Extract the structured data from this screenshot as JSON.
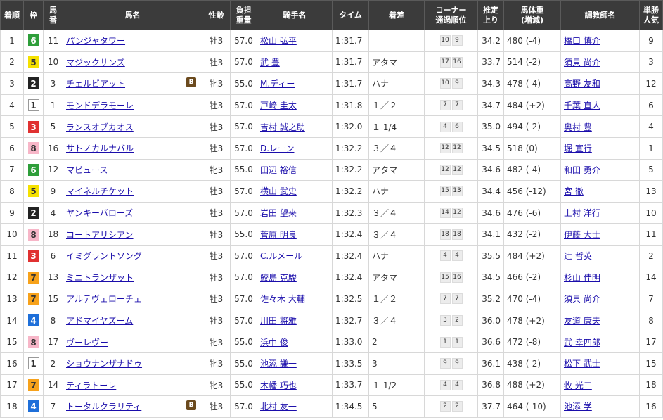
{
  "headers": {
    "rank": "着順",
    "waku": "枠",
    "umaban_1": "馬",
    "umaban_2": "番",
    "horse": "馬名",
    "sex_age": "性齢",
    "weight_1": "負担",
    "weight_2": "重量",
    "jockey": "騎手名",
    "time": "タイム",
    "margin": "着差",
    "corner_1": "コーナー",
    "corner_2": "通過順位",
    "last3f_1": "推定",
    "last3f_2": "上り",
    "body_1": "馬体重",
    "body_2": "(増減)",
    "trainer": "調教師名",
    "pop_1": "単勝",
    "pop_2": "人気"
  },
  "waku_colors": {
    "1": {
      "bg": "#ffffff",
      "fg": "#333333",
      "border": "#999999"
    },
    "2": {
      "bg": "#222222",
      "fg": "#ffffff",
      "border": "#222222"
    },
    "3": {
      "bg": "#e03131",
      "fg": "#ffffff",
      "border": "#e03131"
    },
    "4": {
      "bg": "#1e6fd9",
      "fg": "#ffffff",
      "border": "#1e6fd9"
    },
    "5": {
      "bg": "#f5e100",
      "fg": "#333333",
      "border": "#f5e100"
    },
    "6": {
      "bg": "#2e9e3a",
      "fg": "#ffffff",
      "border": "#2e9e3a"
    },
    "7": {
      "bg": "#f7a21b",
      "fg": "#333333",
      "border": "#f7a21b"
    },
    "8": {
      "bg": "#f7b6c8",
      "fg": "#333333",
      "border": "#f7b6c8"
    }
  },
  "blinker_label": "B",
  "rows": [
    {
      "rank": "1",
      "waku": "6",
      "umaban": "11",
      "horse": "パンジャタワー",
      "blinker": false,
      "sex_age": "牡3",
      "weight": "57.0",
      "jockey": "松山 弘平",
      "time": "1:31.7",
      "margin": "",
      "corner": [
        "10",
        "9"
      ],
      "last3f": "34.2",
      "body": "480 (-4)",
      "trainer": "橋口 慎介",
      "pop": "9"
    },
    {
      "rank": "2",
      "waku": "5",
      "umaban": "10",
      "horse": "マジックサンズ",
      "blinker": false,
      "sex_age": "牡3",
      "weight": "57.0",
      "jockey": "武 豊",
      "time": "1:31.7",
      "margin": "アタマ",
      "corner": [
        "17",
        "16"
      ],
      "last3f": "33.7",
      "body": "514 (-2)",
      "trainer": "須貝 尚介",
      "pop": "3"
    },
    {
      "rank": "3",
      "waku": "2",
      "umaban": "3",
      "horse": "チェルビアット",
      "blinker": true,
      "sex_age": "牝3",
      "weight": "55.0",
      "jockey": "M.ディー",
      "time": "1:31.7",
      "margin": "ハナ",
      "corner": [
        "10",
        "9"
      ],
      "last3f": "34.3",
      "body": "478 (-4)",
      "trainer": "高野 友和",
      "pop": "12"
    },
    {
      "rank": "4",
      "waku": "1",
      "umaban": "1",
      "horse": "モンドデラモーレ",
      "blinker": false,
      "sex_age": "牡3",
      "weight": "57.0",
      "jockey": "戸崎 圭太",
      "time": "1:31.8",
      "margin": "１／２",
      "corner": [
        "7",
        "7"
      ],
      "last3f": "34.7",
      "body": "484 (+2)",
      "trainer": "千葉 直人",
      "pop": "6"
    },
    {
      "rank": "5",
      "waku": "3",
      "umaban": "5",
      "horse": "ランスオブカオス",
      "blinker": false,
      "sex_age": "牡3",
      "weight": "57.0",
      "jockey": "吉村 誠之助",
      "time": "1:32.0",
      "margin": "１ 1/4",
      "corner": [
        "4",
        "6"
      ],
      "last3f": "35.0",
      "body": "494 (-2)",
      "trainer": "奥村 豊",
      "pop": "4"
    },
    {
      "rank": "6",
      "waku": "8",
      "umaban": "16",
      "horse": "サトノカルナバル",
      "blinker": false,
      "sex_age": "牡3",
      "weight": "57.0",
      "jockey": "D.レーン",
      "time": "1:32.2",
      "margin": "３／４",
      "corner": [
        "12",
        "12"
      ],
      "last3f": "34.5",
      "body": "518 (0)",
      "trainer": "堀 宣行",
      "pop": "1"
    },
    {
      "rank": "7",
      "waku": "6",
      "umaban": "12",
      "horse": "マピュース",
      "blinker": false,
      "sex_age": "牝3",
      "weight": "55.0",
      "jockey": "田辺 裕信",
      "time": "1:32.2",
      "margin": "アタマ",
      "corner": [
        "12",
        "12"
      ],
      "last3f": "34.6",
      "body": "482 (-4)",
      "trainer": "和田 勇介",
      "pop": "5"
    },
    {
      "rank": "8",
      "waku": "5",
      "umaban": "9",
      "horse": "マイネルチケット",
      "blinker": false,
      "sex_age": "牡3",
      "weight": "57.0",
      "jockey": "横山 武史",
      "time": "1:32.2",
      "margin": "ハナ",
      "corner": [
        "15",
        "13"
      ],
      "last3f": "34.4",
      "body": "456 (-12)",
      "trainer": "宮 徹",
      "pop": "13"
    },
    {
      "rank": "9",
      "waku": "2",
      "umaban": "4",
      "horse": "ヤンキーバローズ",
      "blinker": false,
      "sex_age": "牡3",
      "weight": "57.0",
      "jockey": "岩田 望来",
      "time": "1:32.3",
      "margin": "３／４",
      "corner": [
        "14",
        "12"
      ],
      "last3f": "34.6",
      "body": "476 (-6)",
      "trainer": "上村 洋行",
      "pop": "10"
    },
    {
      "rank": "10",
      "waku": "8",
      "umaban": "18",
      "horse": "コートアリシアン",
      "blinker": false,
      "sex_age": "牡3",
      "weight": "55.0",
      "jockey": "菅原 明良",
      "time": "1:32.4",
      "margin": "３／４",
      "corner": [
        "18",
        "18"
      ],
      "last3f": "34.1",
      "body": "432 (-2)",
      "trainer": "伊藤 大士",
      "pop": "11"
    },
    {
      "rank": "11",
      "waku": "3",
      "umaban": "6",
      "horse": "イミグラントソング",
      "blinker": false,
      "sex_age": "牡3",
      "weight": "57.0",
      "jockey": "C.ルメール",
      "time": "1:32.4",
      "margin": "ハナ",
      "corner": [
        "4",
        "4"
      ],
      "last3f": "35.5",
      "body": "484 (+2)",
      "trainer": "辻 哲英",
      "pop": "2"
    },
    {
      "rank": "12",
      "waku": "7",
      "umaban": "13",
      "horse": "ミニトランザット",
      "blinker": false,
      "sex_age": "牡3",
      "weight": "57.0",
      "jockey": "鮫島 克駿",
      "time": "1:32.4",
      "margin": "アタマ",
      "corner": [
        "15",
        "16"
      ],
      "last3f": "34.5",
      "body": "466 (-2)",
      "trainer": "杉山 佳明",
      "pop": "14"
    },
    {
      "rank": "13",
      "waku": "7",
      "umaban": "15",
      "horse": "アルテヴェローチェ",
      "blinker": false,
      "sex_age": "牡3",
      "weight": "57.0",
      "jockey": "佐々木 大輔",
      "time": "1:32.5",
      "margin": "１／２",
      "corner": [
        "7",
        "7"
      ],
      "last3f": "35.2",
      "body": "470 (-4)",
      "trainer": "須貝 尚介",
      "pop": "7"
    },
    {
      "rank": "14",
      "waku": "4",
      "umaban": "8",
      "horse": "アドマイヤズーム",
      "blinker": false,
      "sex_age": "牡3",
      "weight": "57.0",
      "jockey": "川田 将雅",
      "time": "1:32.7",
      "margin": "３／４",
      "corner": [
        "3",
        "2"
      ],
      "last3f": "36.0",
      "body": "478 (+2)",
      "trainer": "友道 康夫",
      "pop": "8"
    },
    {
      "rank": "15",
      "waku": "8",
      "umaban": "17",
      "horse": "ヴーレヴー",
      "blinker": false,
      "sex_age": "牝3",
      "weight": "55.0",
      "jockey": "浜中 俊",
      "time": "1:33.0",
      "margin": "2",
      "corner": [
        "1",
        "1"
      ],
      "last3f": "36.6",
      "body": "472 (-8)",
      "trainer": "武 幸四郎",
      "pop": "17"
    },
    {
      "rank": "16",
      "waku": "1",
      "umaban": "2",
      "horse": "ショウナンザナドゥ",
      "blinker": false,
      "sex_age": "牝3",
      "weight": "55.0",
      "jockey": "池添 謙一",
      "time": "1:33.5",
      "margin": "3",
      "corner": [
        "9",
        "9"
      ],
      "last3f": "36.1",
      "body": "438 (-2)",
      "trainer": "松下 武士",
      "pop": "15"
    },
    {
      "rank": "17",
      "waku": "7",
      "umaban": "14",
      "horse": "ティラトーレ",
      "blinker": false,
      "sex_age": "牝3",
      "weight": "55.0",
      "jockey": "木幡 巧也",
      "time": "1:33.7",
      "margin": "１ 1/2",
      "corner": [
        "4",
        "4"
      ],
      "last3f": "36.8",
      "body": "488 (+2)",
      "trainer": "牧 光二",
      "pop": "18"
    },
    {
      "rank": "18",
      "waku": "4",
      "umaban": "7",
      "horse": "トータルクラリティ",
      "blinker": true,
      "sex_age": "牡3",
      "weight": "57.0",
      "jockey": "北村 友一",
      "time": "1:34.5",
      "margin": "5",
      "corner": [
        "2",
        "2"
      ],
      "last3f": "37.7",
      "body": "464 (-10)",
      "trainer": "池添 学",
      "pop": "16"
    }
  ]
}
